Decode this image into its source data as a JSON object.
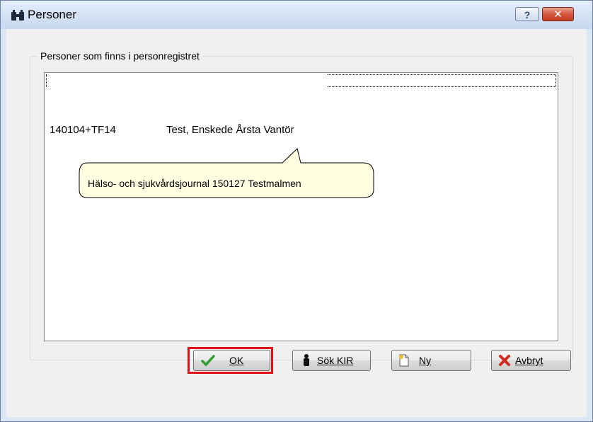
{
  "window": {
    "title": "Personer",
    "help_label": "?",
    "close_label": "✕"
  },
  "group": {
    "legend": "Personer som finns i personregistret"
  },
  "list": {
    "rows": [
      {
        "id": "140104+TF14",
        "name": "Test, Enskede Årsta Vantör"
      }
    ]
  },
  "tooltip": {
    "text": "Hälso- och sjukvårdsjournal 150127 Testmalmen"
  },
  "buttons": {
    "ok": "OK",
    "sok_kir": "Sök KIR",
    "ny": "Ny",
    "avbryt": "Avbryt"
  },
  "icons": {
    "title": "binoculars-icon",
    "ok": "checkmark-icon",
    "sok_kir": "person-icon",
    "ny": "new-document-icon",
    "avbryt": "red-x-icon"
  },
  "colors": {
    "highlight": "#e0121a",
    "tooltip_bg": "#ffffe1",
    "checkmark": "#2f9e2f"
  }
}
